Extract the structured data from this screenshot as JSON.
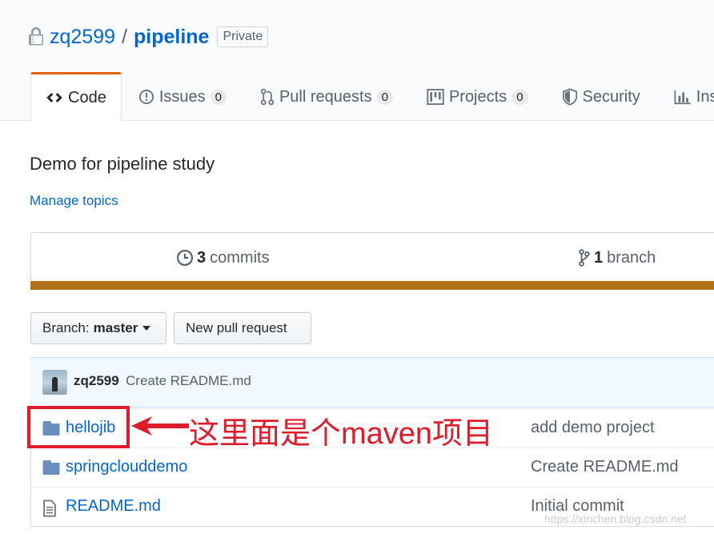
{
  "repo": {
    "owner": "zq2599",
    "separator": "/",
    "name": "pipeline",
    "visibility": "Private",
    "description": "Demo for pipeline study",
    "manage_topics": "Manage topics"
  },
  "tabs": [
    {
      "label": "Code",
      "icon": "code-icon",
      "selected": true
    },
    {
      "label": "Issues",
      "count": "0",
      "icon": "issue-icon"
    },
    {
      "label": "Pull requests",
      "count": "0",
      "icon": "pull-request-icon"
    },
    {
      "label": "Projects",
      "count": "0",
      "icon": "project-icon"
    },
    {
      "label": "Security",
      "icon": "shield-icon"
    },
    {
      "label": "Ins",
      "icon": "graph-icon"
    }
  ],
  "summary": {
    "commits_count": "3",
    "commits_label": "commits",
    "branch_count": "1",
    "branch_label": "branch",
    "language_color": "#b07219"
  },
  "toolbar": {
    "branch_prefix": "Branch:",
    "branch_name": "master",
    "new_pr": "New pull request"
  },
  "latest_commit": {
    "author": "zq2599",
    "message": "Create README.md"
  },
  "files": [
    {
      "name": "hellojib",
      "type": "folder",
      "message": "add demo project"
    },
    {
      "name": "springclouddemo",
      "type": "folder",
      "message": "Create README.md"
    },
    {
      "name": "README.md",
      "type": "file",
      "message": "Initial commit"
    }
  ],
  "annotation": {
    "text": "这里面是个maven项目",
    "color": "#e01b2b"
  },
  "watermark": "https://xinchen.blog.csdn.net"
}
